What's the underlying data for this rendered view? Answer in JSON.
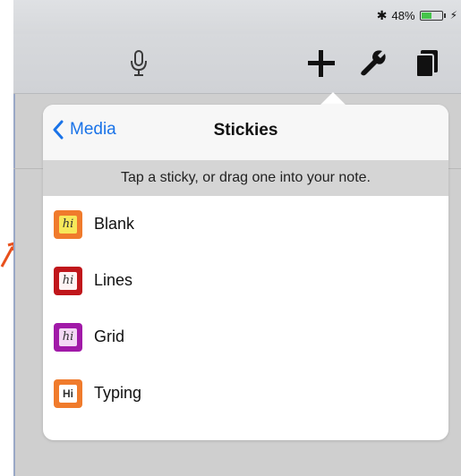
{
  "status_bar": {
    "bluetooth_icon": "bluetooth-icon",
    "battery_percent": "48%",
    "battery_level": 0.48,
    "battery_color": "#45c44a"
  },
  "toolbar": {
    "icons": [
      "microphone-icon",
      "plus-icon",
      "wrench-icon",
      "pages-icon"
    ]
  },
  "popover": {
    "back_label": "Media",
    "title": "Stickies",
    "hint": "Tap a sticky, or drag one into your note.",
    "items": [
      {
        "label": "Blank",
        "icon": "sticky-blank-icon",
        "color": "#f07b2c",
        "inner": "#f7e85a",
        "glyph": "hi"
      },
      {
        "label": "Lines",
        "icon": "sticky-lines-icon",
        "color": "#c0161b",
        "inner": "#fff3f3",
        "glyph": "hi"
      },
      {
        "label": "Grid",
        "icon": "sticky-grid-icon",
        "color": "#a11aa8",
        "inner": "#f3d9f5",
        "glyph": "hi"
      },
      {
        "label": "Typing",
        "icon": "sticky-typing-icon",
        "color": "#f07b2c",
        "inner": "#ffffff",
        "glyph": "Hi"
      }
    ]
  },
  "colors": {
    "accent": "#1a73e8",
    "annotation_arrow": "#e8501c"
  }
}
